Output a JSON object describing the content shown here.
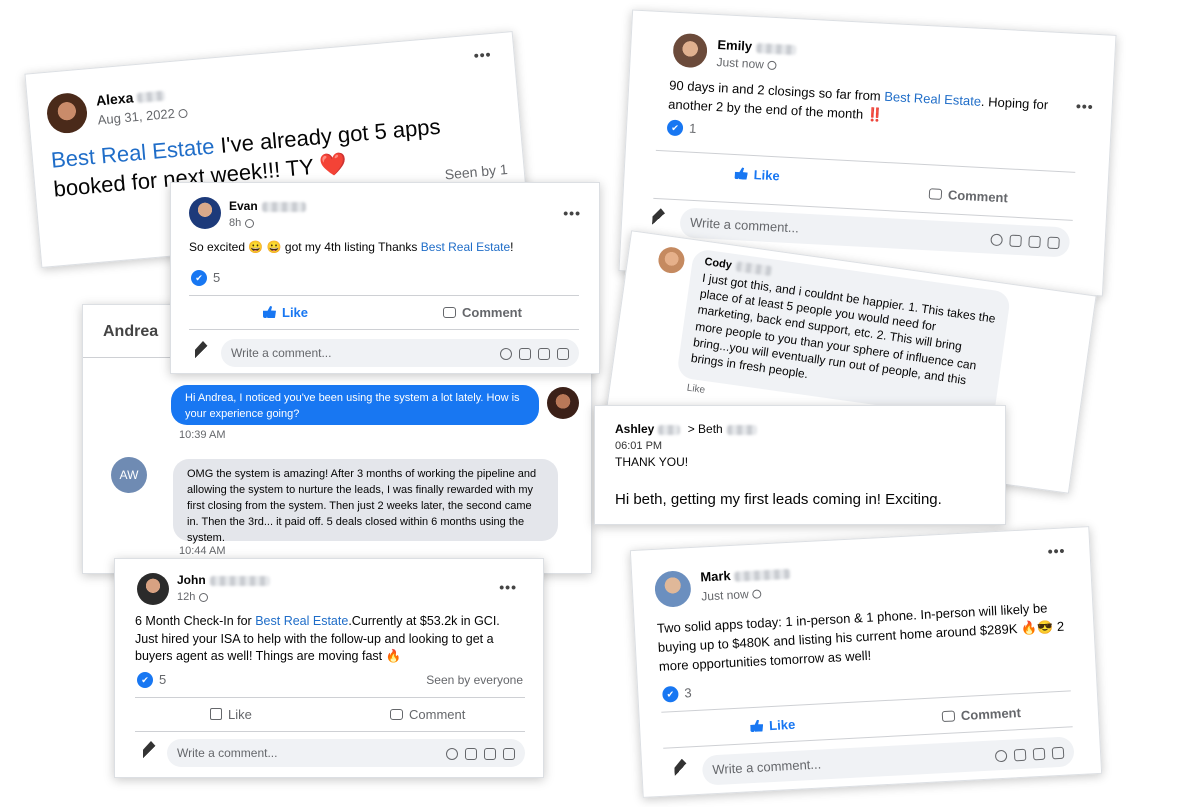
{
  "alexa": {
    "name": "Alexa",
    "date": "Aug 31, 2022",
    "brand": "Best Real Estate",
    "text": " I've already got 5 apps booked for next week!!! TY ❤️",
    "seen": "Seen by 1",
    "more": "•••"
  },
  "evan": {
    "name": "Evan",
    "time": "8h",
    "text_before": "So excited 😀 😀 got my 4th listing Thanks ",
    "brand": "Best Real Estate",
    "text_after": "!",
    "likes": "5",
    "like_label": "Like",
    "comment_label": "Comment",
    "write_placeholder": "Write a comment...",
    "more": "•••"
  },
  "emily": {
    "name": "Emily",
    "time": "Just now",
    "text_before": "90 days in and 2 closings so far from ",
    "brand": "Best Real Estate",
    "text_after": ". Hoping for another 2 by the end of the month ‼️",
    "likes": "1",
    "like_label": "Like",
    "comment_label": "Comment",
    "write_placeholder": "Write a comment...",
    "more": "•••"
  },
  "cody": {
    "name": "Cody",
    "text": "I just got this, and i couldnt be happier. 1. This takes the place of at least 5 people you would need for marketing, back end support, etc. 2. This will bring more people to you than your sphere of influence can bring...you will eventually run out of people, and this brings in fresh people.",
    "like_label": "Like"
  },
  "andrea": {
    "header": "Andrea",
    "msg1": "Hi Andrea, I noticed you've been using the system a lot lately. How is your experience going?",
    "time1": "10:39 AM",
    "avatar_initials": "AW",
    "msg2": "OMG the system is amazing! After 3 months of working the pipeline and allowing the system to nurture the leads, I was finally rewarded with my first closing from the system. Then just 2 weeks later, the second came in. Then the 3rd... it paid off. 5 deals closed within 6 months using the system.",
    "time2": "10:44 AM"
  },
  "ashley": {
    "from": "Ashley",
    "to_prefix": "> Beth",
    "time": "06:01 PM",
    "subject": "THANK YOU!",
    "body": "Hi beth, getting my first leads coming in! Exciting."
  },
  "john": {
    "name": "John",
    "time": "12h",
    "text_before": "6 Month Check-In for ",
    "brand": "Best Real Estate",
    "text_after": ".Currently at $53.2k in GCI. Just hired your ISA to help with the follow-up and looking to get a buyers agent as well! Things are moving fast 🔥",
    "likes": "5",
    "seen": "Seen by everyone",
    "like_label": "Like",
    "comment_label": "Comment",
    "write_placeholder": "Write a comment...",
    "more": "•••"
  },
  "mark": {
    "name": "Mark",
    "time": "Just now",
    "text": "Two solid apps today: 1 in-person & 1 phone. In-person will likely be buying up to $480K and listing his current home around $289K 🔥😎 2 more opportunities tomorrow as well!",
    "likes": "3",
    "like_label": "Like",
    "comment_label": "Comment",
    "write_placeholder": "Write a comment...",
    "more": "•••"
  },
  "colors": {
    "brand_link": "#1f6dc8",
    "facebook_blue": "#1877f2",
    "message_blue": "#1877f2"
  }
}
